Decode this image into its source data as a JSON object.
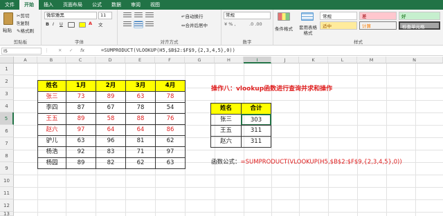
{
  "menu": {
    "tabs": [
      "文件",
      "开始",
      "插入",
      "页面布局",
      "公式",
      "数据",
      "审阅",
      "视图"
    ],
    "active": 1
  },
  "ribbon": {
    "clipboard": {
      "paste": "粘贴",
      "cut": "剪切",
      "copy": "复制",
      "format_painter": "格式刷",
      "label": "剪贴板"
    },
    "font": {
      "name": "微软雅黑",
      "size": "11",
      "bold": "B",
      "italic": "I",
      "underline": "U",
      "grow": "A",
      "shrink": "A",
      "wen": "文",
      "label": "字体"
    },
    "alignment": {
      "wrap": "自动换行",
      "merge": "合并后居中",
      "label": "对齐方式"
    },
    "number": {
      "format": "常规",
      "label": "数字"
    },
    "styles": {
      "conditional": "条件格式",
      "table": "套用表格格式",
      "normal": "常规",
      "bad": "差",
      "good": "好",
      "neutral": "适中",
      "calc": "计算",
      "check": "检查单元格",
      "label": "样式"
    }
  },
  "formula_bar": {
    "namebox": "I5",
    "fx": "fx",
    "formula": "=SUMPRODUCT(VLOOKUP(H5,$B$2:$F$9,{2,3,4,5},0))"
  },
  "columns": [
    "A",
    "B",
    "C",
    "D",
    "E",
    "F",
    "G",
    "H",
    "I",
    "J",
    "K",
    "L",
    "M",
    "N"
  ],
  "rows": [
    "1",
    "2",
    "3",
    "4",
    "5",
    "6",
    "7",
    "8",
    "9",
    "10",
    "11",
    "12",
    "13",
    "14",
    "15",
    "16"
  ],
  "table1": {
    "headers": [
      "姓名",
      "1月",
      "2月",
      "3月",
      "4月"
    ],
    "rows": [
      {
        "name": "张三",
        "vals": [
          "73",
          "89",
          "63",
          "78"
        ],
        "red": true
      },
      {
        "name": "李四",
        "vals": [
          "87",
          "67",
          "78",
          "54"
        ],
        "red": false
      },
      {
        "name": "王五",
        "vals": [
          "89",
          "58",
          "88",
          "76"
        ],
        "red": true
      },
      {
        "name": "赵六",
        "vals": [
          "97",
          "64",
          "64",
          "86"
        ],
        "red": true
      },
      {
        "name": "驴儿",
        "vals": [
          "63",
          "96",
          "81",
          "62"
        ],
        "red": false
      },
      {
        "name": "杨浩",
        "vals": [
          "92",
          "83",
          "71",
          "97"
        ],
        "red": false
      },
      {
        "name": "杨园",
        "vals": [
          "89",
          "82",
          "62",
          "63"
        ],
        "red": false
      }
    ]
  },
  "title": "操作八：vlookup函数进行查询并求和操作",
  "table2": {
    "headers": [
      "姓名",
      "合计"
    ],
    "rows": [
      {
        "name": "张三",
        "total": "303"
      },
      {
        "name": "王五",
        "total": "311"
      },
      {
        "name": "赵六",
        "total": "311"
      }
    ]
  },
  "formula_note": {
    "label": "函数公式：",
    "formula": "=SUMPRODUCT(VLOOKUP(H5,$B$2:$F$9,{2,3,4,5},0))"
  },
  "colors": {
    "excel_green": "#217346",
    "header_yellow": "#ffff00",
    "red": "#e02020"
  }
}
